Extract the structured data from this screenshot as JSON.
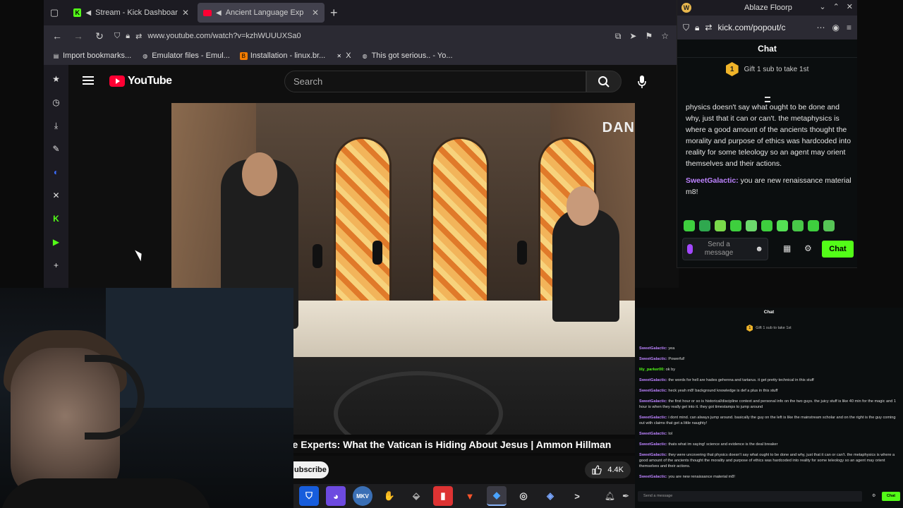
{
  "browser": {
    "tabs": [
      {
        "label": "Stream - Kick Dashboar",
        "icon": "kick-icon",
        "active": false
      },
      {
        "label": "Ancient Language Exp",
        "icon": "youtube-icon",
        "active": true
      }
    ],
    "url": "www.youtube.com/watch?v=kzhWUUUXSa0",
    "bookmarks": [
      {
        "label": "Import bookmarks...",
        "icon": "import-icon"
      },
      {
        "label": "Emulator files - Emul...",
        "icon": "globe-icon"
      },
      {
        "label": "Installation - linux.br...",
        "icon": "blogger-icon"
      },
      {
        "label": "X",
        "icon": "x-icon"
      },
      {
        "label": "This got serious.. - Yo...",
        "icon": "globe-icon"
      }
    ],
    "sidebar_icons": [
      "star-icon",
      "history-icon",
      "download-icon",
      "pen-icon",
      "kick-side-icon",
      "x-side-icon",
      "kick-green-icon",
      "play-icon",
      "add-icon"
    ]
  },
  "youtube": {
    "logo_text": "YouTube",
    "search_placeholder": "Search",
    "video_title": "ge Experts: What the Vatican is Hiding About Jesus | Ammon Hillman",
    "subscribe_label": "ubscribe",
    "like_count": "4.4K",
    "channel_watermark": "DAN"
  },
  "kick_popout": {
    "window_title": "Ablaze Floorp",
    "url": "kick.com/popout/c",
    "chat_header": "Chat",
    "gift_badge": "1",
    "gift_text": "Gift 1 sub to take 1st",
    "messages": [
      {
        "user": "",
        "text": "physics doesn't say what ought to be done and why, just that it can or can't. the metaphysics is where a good amount of the ancients thought the morality and purpose of ethics was hardcoded into reality for some teleology so an agent may orient themselves and their actions."
      },
      {
        "user": "SweetGalactic:",
        "text": "you are new renaissance material m8!"
      }
    ],
    "input_placeholder": "Send a message",
    "chat_button": "Chat"
  },
  "overlay": {
    "chat_header": "Chat",
    "gift_badge": "1",
    "gift_text": "Gift 1 sub to take 1st",
    "messages": [
      {
        "user": "SweetGalactic:",
        "text": "yea",
        "color": "green"
      },
      {
        "user": "SweetGalactic:",
        "text": "Powerful!",
        "color": "green"
      },
      {
        "user": "lily_parker00:",
        "text": "ok by",
        "color": "green"
      },
      {
        "user": "SweetGalactic:",
        "text": "the words for hell are hades gehenna and tartarus. it get pretty technical in this stuff",
        "color": "green"
      },
      {
        "user": "SweetGalactic:",
        "text": "heck yeah m8! background knowledge is def a plus in this stuff",
        "color": "green"
      },
      {
        "user": "SweetGalactic:",
        "text": "the first hour or so is historical/discipline context and personal info on the two guys. the juicy stuff is like 40 min for the magic and 1 hour is when they really get into it. they got timestamps to jump around",
        "color": "green"
      },
      {
        "user": "SweetGalactic:",
        "text": "i dont mind. can always jump around. basically the guy on the left is like the mainstream scholar and on the right is the guy coming out with claims that get a little naughty!",
        "color": "green"
      },
      {
        "user": "SweetGalactic:",
        "text": "lol",
        "color": "green"
      },
      {
        "user": "SweetGalactic:",
        "text": "thats what im saying! science and evidence is the deal breaker",
        "color": "green"
      },
      {
        "user": "SweetGalactic:",
        "text": "they were uncovering that physics doesn't say what ought to be done and why, just that it can or can't. the metaphysics is where a good amount of the ancients thought the morality and purpose of ethics was hardcoded into reality for some teleology so an agent may orient themselves and their actions.",
        "color": "green"
      },
      {
        "user": "SweetGalactic:",
        "text": "you are new renaissance material m8!",
        "color": "green"
      }
    ],
    "input_placeholder": "Send a message",
    "chat_button": "Chat"
  },
  "taskbar": {
    "icons": [
      "bitwarden-icon",
      "emulator-icon",
      "mkv-icon",
      "wave-icon",
      "archive-icon",
      "app-red-icon",
      "brave-icon",
      "floorp-icon",
      "obs-icon",
      "layers-icon",
      "terminal-icon"
    ],
    "tray_icons": [
      "notification-icon",
      "feather-icon"
    ],
    "mkv_label": "MKV"
  },
  "colors": {
    "kick_green": "#53fc18",
    "youtube_red": "#ff0033",
    "chat_user_purple": "#bd83ff"
  }
}
